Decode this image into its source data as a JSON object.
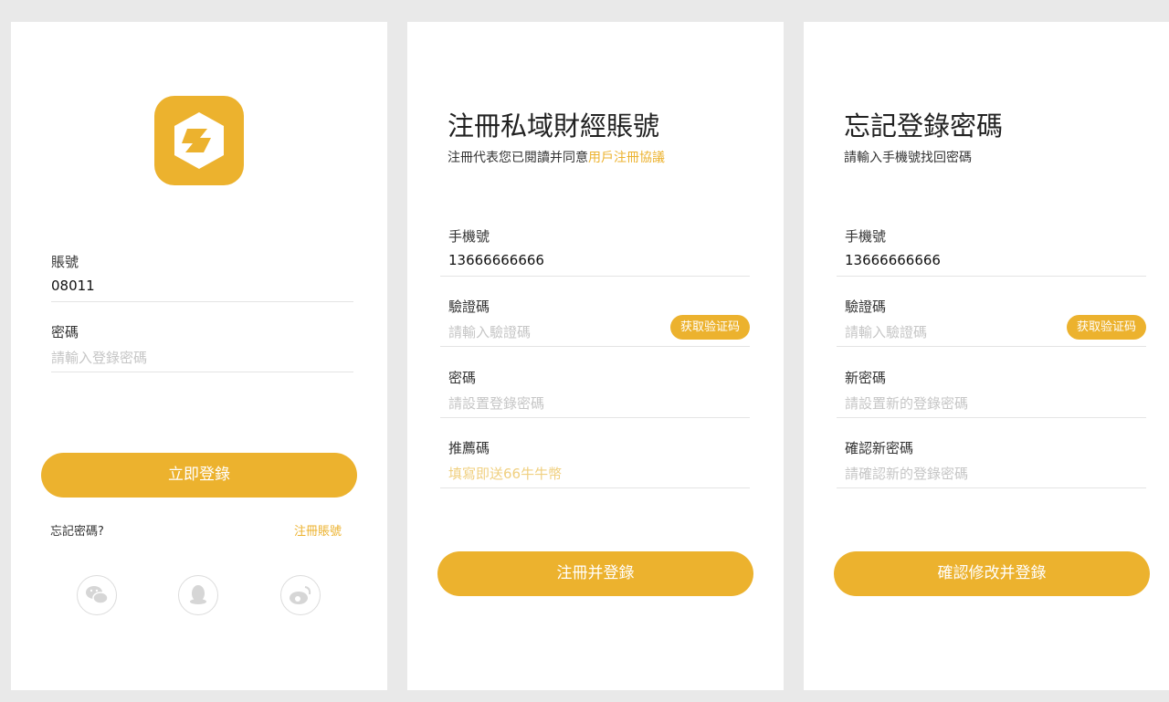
{
  "login": {
    "account_label": "賬號",
    "account_value": "08011",
    "password_label": "密碼",
    "password_placeholder": "請輸入登錄密碼",
    "submit_label": "立即登錄",
    "forgot_link": "忘記密碼?",
    "register_link": "注冊賬號",
    "social_icons": [
      "wechat-icon",
      "qq-icon",
      "weibo-icon"
    ]
  },
  "register": {
    "title": "注冊私域財經賬號",
    "subtitle_prefix": "注冊代表您已閱讀并同意",
    "agreement_link": "用戶注冊協議",
    "phone_label": "手機號",
    "phone_value": "13666666666",
    "code_label": "驗證碼",
    "code_placeholder": "請輸入驗證碼",
    "code_button": "获取验证码",
    "password_label": "密碼",
    "password_placeholder": "請設置登錄密碼",
    "referral_label": "推薦碼",
    "referral_placeholder": "填寫即送66牛牛幣",
    "submit_label": "注冊并登錄"
  },
  "forgot": {
    "title": "忘記登錄密碼",
    "subtitle": "請輸入手機號找回密碼",
    "phone_label": "手機號",
    "phone_value": "13666666666",
    "code_label": "驗證碼",
    "code_placeholder": "請輸入驗證碼",
    "code_button": "获取验证码",
    "new_password_label": "新密碼",
    "new_password_placeholder": "請設置新的登錄密碼",
    "confirm_label": "確認新密碼",
    "confirm_placeholder": "請確認新的登錄密碼",
    "submit_label": "確認修改并登錄"
  },
  "colors": {
    "accent": "#ecb22e",
    "background": "#e9e9e9",
    "panel": "#ffffff",
    "placeholder": "#c6c6c6",
    "referral_placeholder": "#f0d080"
  }
}
